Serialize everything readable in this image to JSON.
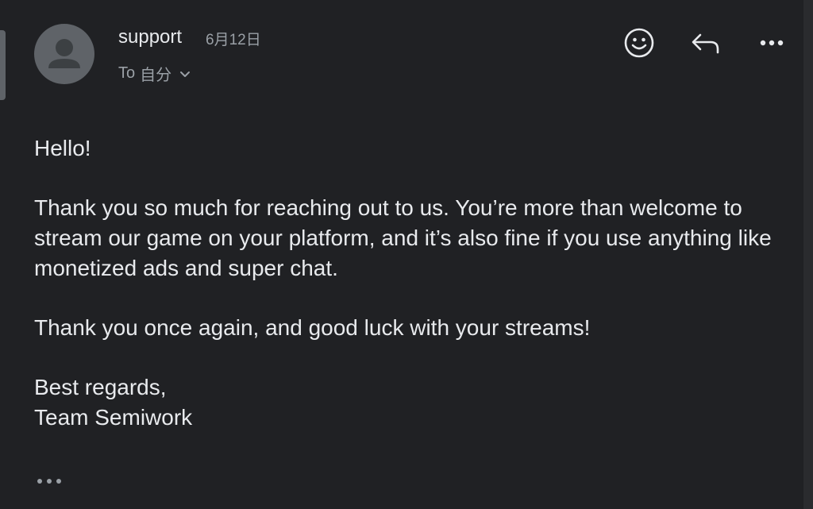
{
  "email": {
    "sender": "support",
    "date": "6月12日",
    "to_prefix": "To",
    "to_name": "自分",
    "body": {
      "greeting": "Hello!",
      "paragraph1": "Thank you so much for reaching out to us. You’re more than welcome to stream our game on your platform, and it’s also fine if you use anything like monetized ads and super chat.",
      "paragraph2": "Thank you once again, and good luck with your streams!",
      "closing": "Best regards,",
      "signature": "Team Semiwork"
    }
  },
  "actions": {
    "react_icon": "emoji-icon",
    "reply_icon": "reply-icon",
    "more_icon": "more-horizontal-icon"
  },
  "colors": {
    "background": "#202124",
    "text_primary": "#e8eaed",
    "text_secondary": "#9aa0a6",
    "avatar": "#5f6368"
  }
}
